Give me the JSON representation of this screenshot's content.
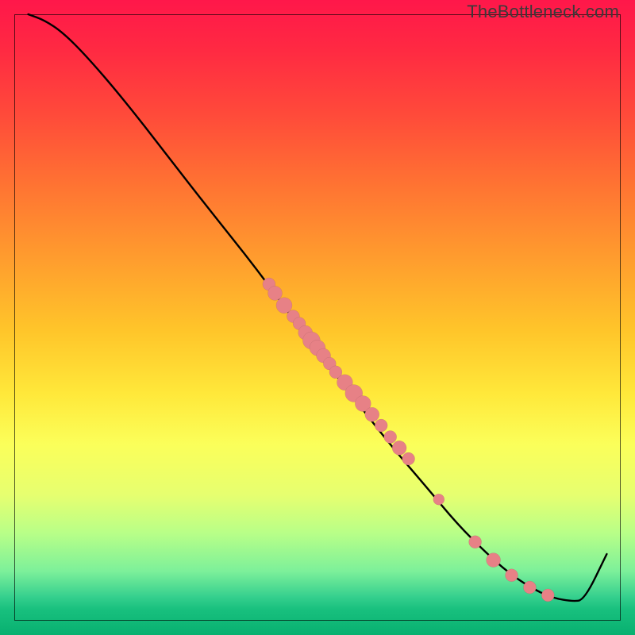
{
  "watermark": "TheBottleneck.com",
  "chart_data": {
    "type": "line",
    "title": "",
    "xlabel": "",
    "ylabel": "",
    "xlim": [
      0,
      100
    ],
    "ylim": [
      0,
      100
    ],
    "curve": {
      "x": [
        2.3,
        5,
        8,
        12,
        18,
        25,
        32,
        40,
        48,
        55,
        62,
        68,
        73,
        78,
        82,
        86,
        89,
        92,
        94,
        97.7
      ],
      "y": [
        100,
        99,
        97,
        93,
        86,
        77,
        68,
        58,
        47,
        38,
        29,
        22,
        16,
        11,
        7.5,
        5,
        3.7,
        3.2,
        3.4,
        11
      ]
    },
    "scatter_overlay": {
      "x": [
        42,
        43,
        44.5,
        46,
        47,
        48,
        49,
        50,
        51,
        52,
        53,
        54.5,
        56,
        57.5,
        59,
        60.5,
        62,
        63.5,
        65,
        70,
        76,
        79,
        82,
        85,
        88
      ],
      "y": [
        55.5,
        54,
        52,
        50.2,
        49,
        47.5,
        46.2,
        45,
        43.7,
        42.4,
        41,
        39.3,
        37.5,
        35.8,
        34,
        32.2,
        30.3,
        28.5,
        26.7,
        20,
        13,
        10,
        7.5,
        5.5,
        4.2
      ],
      "r": [
        8,
        9,
        10,
        8,
        8,
        9,
        11,
        10,
        9,
        8,
        8,
        10,
        11,
        10,
        9,
        8,
        8,
        9,
        8,
        7,
        8,
        9,
        8,
        8,
        8
      ]
    }
  },
  "colors": {
    "curve": "#000000",
    "dot": "#e78186"
  }
}
